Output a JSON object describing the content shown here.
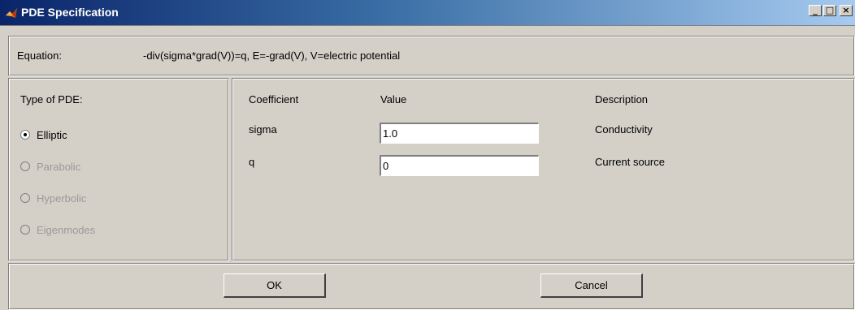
{
  "window": {
    "title": "PDE Specification",
    "controls": {
      "minimize": "_",
      "maximize": "□",
      "close": "×"
    }
  },
  "equation": {
    "label": "Equation:",
    "text": "-div(sigma*grad(V))=q, E=-grad(V), V=electric potential"
  },
  "pde_type": {
    "heading": "Type of PDE:",
    "options": [
      {
        "label": "Elliptic",
        "selected": true,
        "enabled": true
      },
      {
        "label": "Parabolic",
        "selected": false,
        "enabled": false
      },
      {
        "label": "Hyperbolic",
        "selected": false,
        "enabled": false
      },
      {
        "label": "Eigenmodes",
        "selected": false,
        "enabled": false
      }
    ]
  },
  "coefficients": {
    "headers": {
      "coefficient": "Coefficient",
      "value": "Value",
      "description": "Description"
    },
    "rows": [
      {
        "name": "sigma",
        "value": "1.0",
        "description": "Conductivity"
      },
      {
        "name": "q",
        "value": "0",
        "description": "Current source"
      }
    ]
  },
  "buttons": {
    "ok": "OK",
    "cancel": "Cancel"
  },
  "colors": {
    "titlebar_start": "#0a246a",
    "titlebar_end": "#a6caf0",
    "face": "#d4d0c8",
    "disabled_text": "#9a9a9a"
  }
}
